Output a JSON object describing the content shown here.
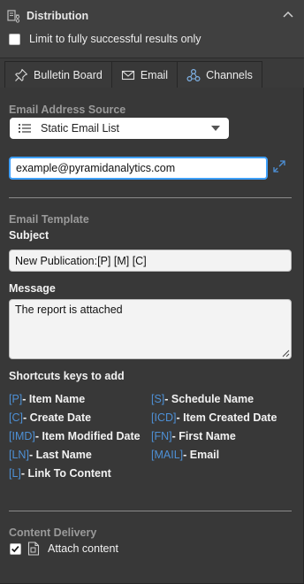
{
  "header": {
    "title": "Distribution",
    "icon": "distribution-icon",
    "collapse_icon": "chevron-up-icon",
    "limit_checkbox": {
      "label": "Limit to fully successful results only",
      "checked": false
    }
  },
  "tabs": [
    {
      "label": "Bulletin Board",
      "icon": "pin-icon",
      "active": false
    },
    {
      "label": "Email",
      "icon": "envelope-icon",
      "active": true
    },
    {
      "label": "Channels",
      "icon": "channels-icon",
      "active": false
    }
  ],
  "email": {
    "source_label": "Email Address Source",
    "source_value": "Static Email List",
    "source_icon": "list-icon",
    "address_value": "example@pyramidanalytics.com",
    "expand_icon": "expand-icon",
    "template_label": "Email Template",
    "subject_label": "Subject",
    "subject_value": "New Publication:[P] [M] [C]",
    "message_label": "Message",
    "message_value": "The report is attached",
    "shortcuts_label": "Shortcuts keys to add",
    "shortcuts_left": [
      {
        "code": "[P]",
        "name": "- Item Name"
      },
      {
        "code": "[C]",
        "name": "- Create Date"
      },
      {
        "code": "[IMD]",
        "name": "- Item Modified Date"
      },
      {
        "code": "[LN]",
        "name": "- Last Name"
      },
      {
        "code": "[L]",
        "name": "- Link To Content"
      }
    ],
    "shortcuts_right": [
      {
        "code": "[S]",
        "name": "- Schedule Name"
      },
      {
        "code": "[ICD]",
        "name": "- Item Created Date"
      },
      {
        "code": "[FN]",
        "name": "- First Name"
      },
      {
        "code": "[MAIL]",
        "name": "- Email"
      }
    ]
  },
  "content_delivery": {
    "label": "Content Delivery",
    "attach_label": "Attach content",
    "attach_checked": true,
    "attach_icon": "file-icon"
  },
  "colors": {
    "accent": "#3ea0ff",
    "shortcut_code": "#4d90d6",
    "panel_bg": "#383838",
    "header_bg": "#404040"
  }
}
